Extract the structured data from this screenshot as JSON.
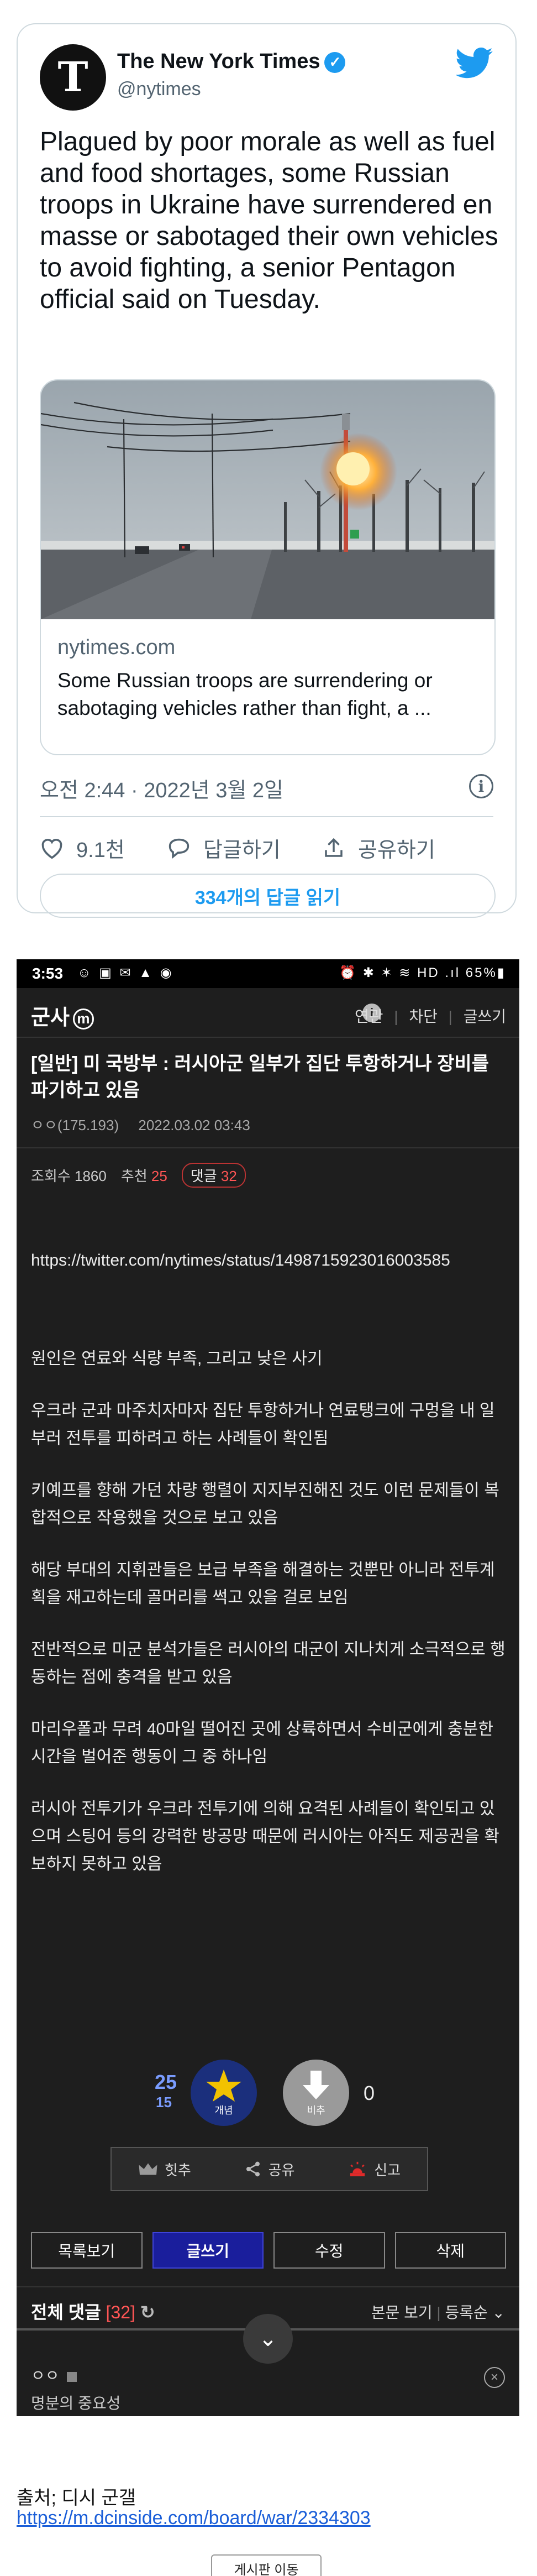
{
  "tweet": {
    "author_name": "The New York Times",
    "author_handle": "@nytimes",
    "avatar_glyph": "T",
    "text": "Plagued by poor morale as well as fuel and food shortages, some Russian troops in Ukraine have surrendered en masse or sabotaged their own vehicles to avoid fighting, a senior Pentagon official said on Tuesday.",
    "link_domain": "nytimes.com",
    "link_description": "Some Russian troops are surrendering or sabotaging vehicles rather than fight, a ...",
    "timestamp": "오전 2:44 · 2022년 3월 2일",
    "likes": "9.1천",
    "reply_label": "답글하기",
    "share_label": "공유하기",
    "read_replies": "334개의 답글 읽기",
    "colors": {
      "accent": "#1d9bf0",
      "text": "#0f1419",
      "muted": "#536471",
      "border": "#cfd9de"
    }
  },
  "dc": {
    "status_bar": {
      "time": "3:53",
      "left_icons": "☺ ▣ ✉ ▲ ◉",
      "right_icons": "⏰ ✱ ✶ ≋ HD .ıl 65%▮"
    },
    "nav": {
      "gallery_name": "군사",
      "badge": "m",
      "links": [
        "연관",
        "차단",
        "글쓰기"
      ]
    },
    "post": {
      "title": "[일반] 미 국방부 : 러시아군 일부가 집단 투항하거나 장비를 파기하고 있음",
      "author": "ㅇㅇ(175.193)",
      "date": "2022.03.02 03:43",
      "views_label": "조회수 1860",
      "recommend_label": "추천",
      "recommend_count": "25",
      "comments_label": "댓글",
      "comments_count": "32",
      "body": [
        "https://twitter.com/nytimes/status/1498715923016003585",
        "원인은 연료와 식량 부족, 그리고 낮은 사기",
        "우크라 군과 마주치자마자 집단 투항하거나 연료탱크에 구멍을 내 일부러 전투를 피하려고 하는 사례들이 확인됨",
        "키예프를 향해 가던 차량 행렬이 지지부진해진 것도 이런 문제들이 복합적으로 작용했을 것으로 보고 있음",
        "해당 부대의 지휘관들은 보급 부족을 해결하는 것뿐만 아니라 전투계획을 재고하는데 골머리를 썩고 있을 걸로 보임",
        "전반적으로 미군 분석가들은 러시아의 대군이 지나치게 소극적으로 행동하는 점에 충격을 받고 있음",
        "마리우폴과 무려 40마일 떨어진 곳에 상륙하면서 수비군에게 충분한 시간을 벌어준 행동이 그 중 하나임",
        "러시아 전투기가 우크라 전투기에 의해 요격된 사례들이 확인되고 있으며 스팅어 등의 강력한 방공망 때문에 러시아는 아직도 제공권을 확보하지 못하고 있음"
      ]
    },
    "votes": {
      "up_count": "25",
      "fixed_count": "15",
      "up_label": "개념",
      "down_label": "비추",
      "down_count": "0"
    },
    "share_bar": {
      "hit": "힛추",
      "share": "공유",
      "report": "신고"
    },
    "buttons": {
      "list": "목록보기",
      "write": "글쓰기",
      "edit": "수정",
      "delete": "삭제"
    },
    "comments": {
      "title": "전체 댓글",
      "count": "[32]",
      "view_body": "본문 보기",
      "sort": "등록순",
      "first_author": "ㅇㅇ",
      "first_text": "명분의 중요성"
    },
    "colors": {
      "background": "#1e1e1e",
      "primary_button": "#1a1e9c",
      "highlight": "#ff5555",
      "vote_up": "#1b2f7c"
    }
  },
  "footer": {
    "source_label": "출처; 디시 군갤",
    "source_url": "https://m.dcinside.com/board/war/2334303",
    "more_button": "게시판 이동"
  }
}
